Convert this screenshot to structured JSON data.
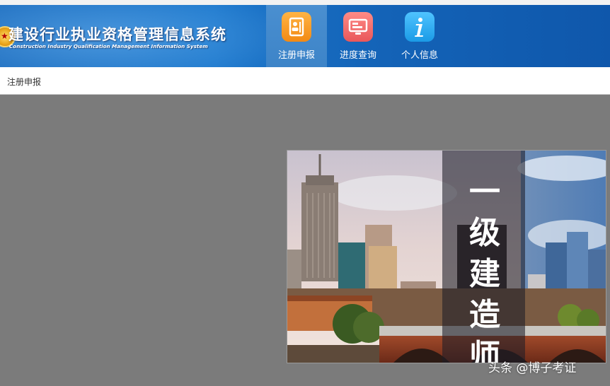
{
  "header": {
    "system_title": "建设行业执业资格管理信息系统",
    "system_subtitle": "Construction Industry Qualification Management Information System",
    "logo_text": "★",
    "nav": [
      {
        "label": "注册申报",
        "icon": "profile-card-icon",
        "active": true
      },
      {
        "label": "进度查询",
        "icon": "monitor-icon",
        "active": false
      },
      {
        "label": "个人信息",
        "icon": "info-icon",
        "active": false
      }
    ]
  },
  "breadcrumb": {
    "current": "注册申报"
  },
  "banner": {
    "title_chars": [
      "一",
      "级",
      "建",
      "造",
      "师"
    ]
  },
  "watermark": "头条 @博子考证",
  "colors": {
    "header_blue": "#1b77cc",
    "page_background": "#7b7b7b",
    "register_icon": "#f28a14",
    "progress_icon": "#e9575a",
    "info_icon": "#1b9be6"
  }
}
